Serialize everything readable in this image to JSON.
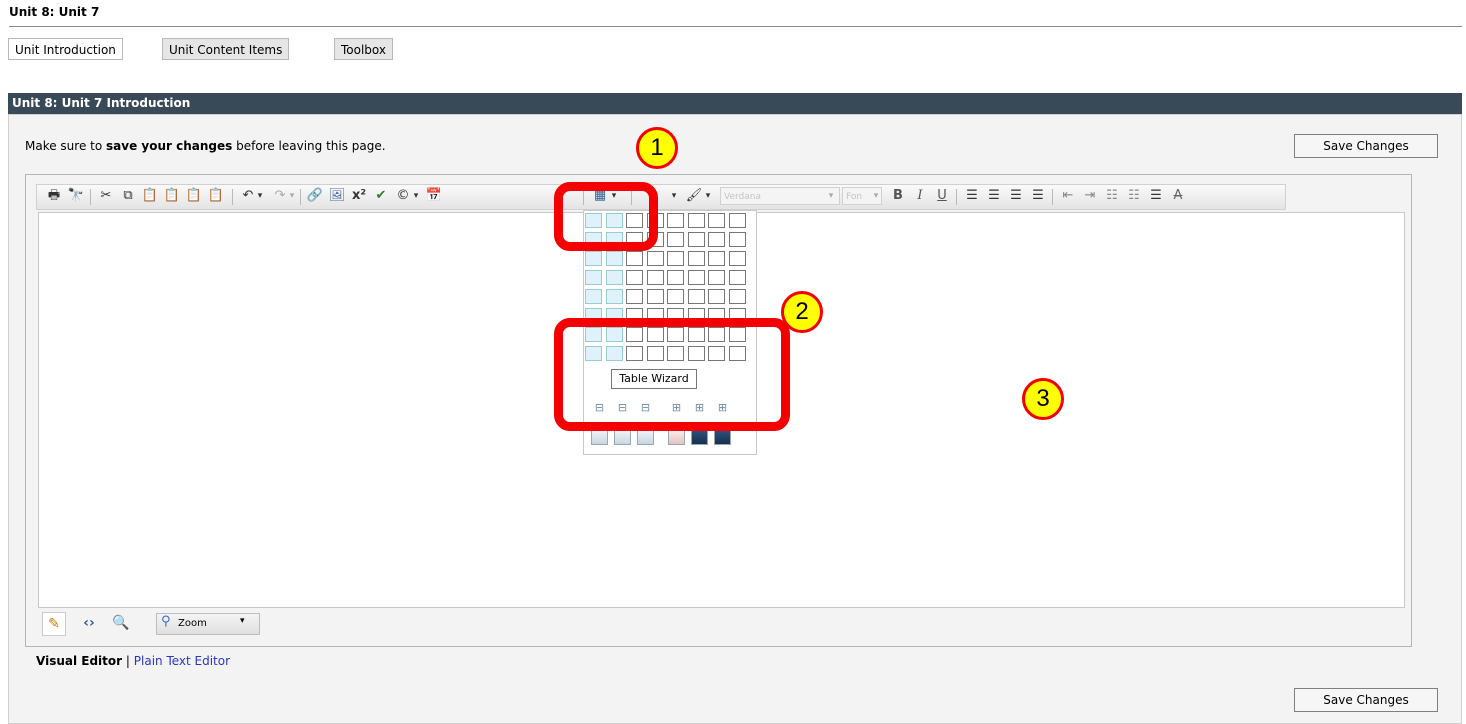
{
  "page": {
    "title": "Unit 8: Unit 7",
    "tabs": [
      "Unit Introduction",
      "Unit Content Items",
      "Toolbox"
    ],
    "section_title": "Unit 8: Unit 7 Introduction",
    "notice": {
      "before": "Make sure to ",
      "emphasis": "save your changes",
      "after": " before leaving this page."
    },
    "save_label": "Save Changes"
  },
  "editor": {
    "font_name_combo": "Verdana",
    "font_size_combo": "Fon",
    "zoom_label": "Zoom",
    "tooltip": "Table Wizard",
    "mode_active": "Visual Editor",
    "mode_separator": "|",
    "mode_link": "Plain Text Editor"
  },
  "table_picker": {
    "columns": 8,
    "rows": 8,
    "highlighted_columns": 2
  },
  "annotations": {
    "badge_1": "1",
    "badge_2": "2",
    "badge_3": "3"
  },
  "colors": {
    "header_bg": "#384a57",
    "callout_red": "#f40000",
    "badge_yellow": "#ffff00",
    "link_blue": "#2a35c6"
  }
}
